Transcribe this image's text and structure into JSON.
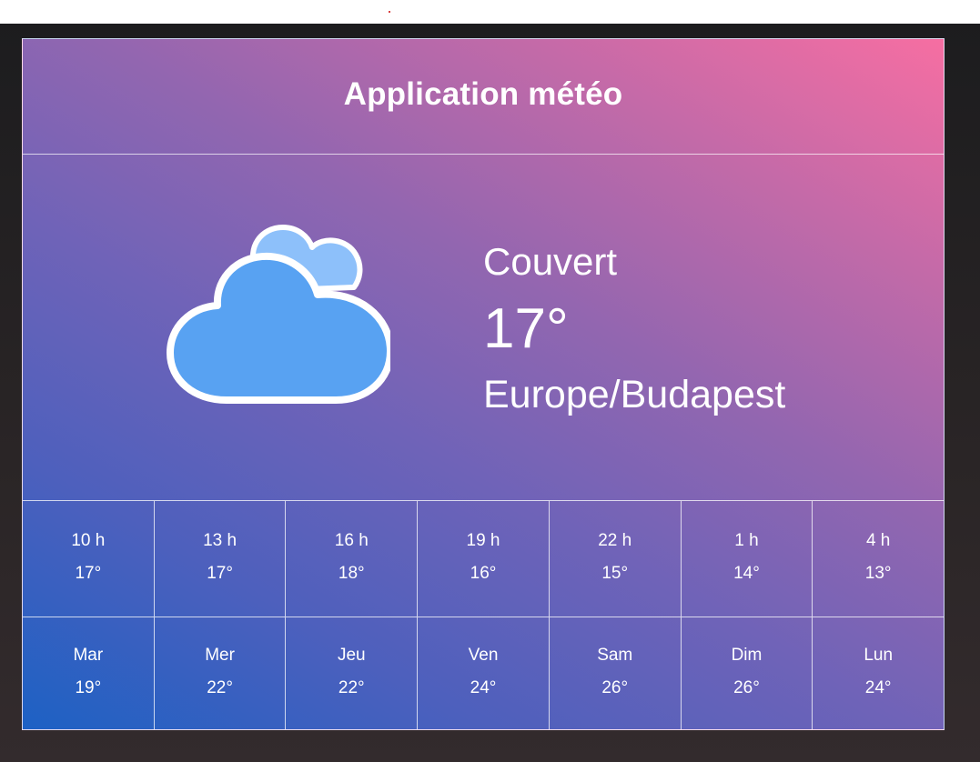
{
  "app": {
    "title": "Application météo"
  },
  "current": {
    "icon": "cloud-icon",
    "condition": "Couvert",
    "temperature": "17°",
    "location": "Europe/Budapest"
  },
  "hourly": [
    {
      "label": "10 h",
      "temp": "17°"
    },
    {
      "label": "13 h",
      "temp": "17°"
    },
    {
      "label": "16 h",
      "temp": "18°"
    },
    {
      "label": "19 h",
      "temp": "16°"
    },
    {
      "label": "22 h",
      "temp": "15°"
    },
    {
      "label": "1 h",
      "temp": "14°"
    },
    {
      "label": "4 h",
      "temp": "13°"
    }
  ],
  "daily": [
    {
      "label": "Mar",
      "temp": "19°"
    },
    {
      "label": "Mer",
      "temp": "22°"
    },
    {
      "label": "Jeu",
      "temp": "22°"
    },
    {
      "label": "Ven",
      "temp": "24°"
    },
    {
      "label": "Sam",
      "temp": "26°"
    },
    {
      "label": "Dim",
      "temp": "26°"
    },
    {
      "label": "Lun",
      "temp": "24°"
    }
  ],
  "colors": {
    "gradient_start": "#1d61c4",
    "gradient_mid": "#9266b0",
    "gradient_end": "#f66ea2",
    "cloud_front": "#58a2f2",
    "cloud_back": "#8dc0fa",
    "page_background": "#1c1c1e"
  }
}
